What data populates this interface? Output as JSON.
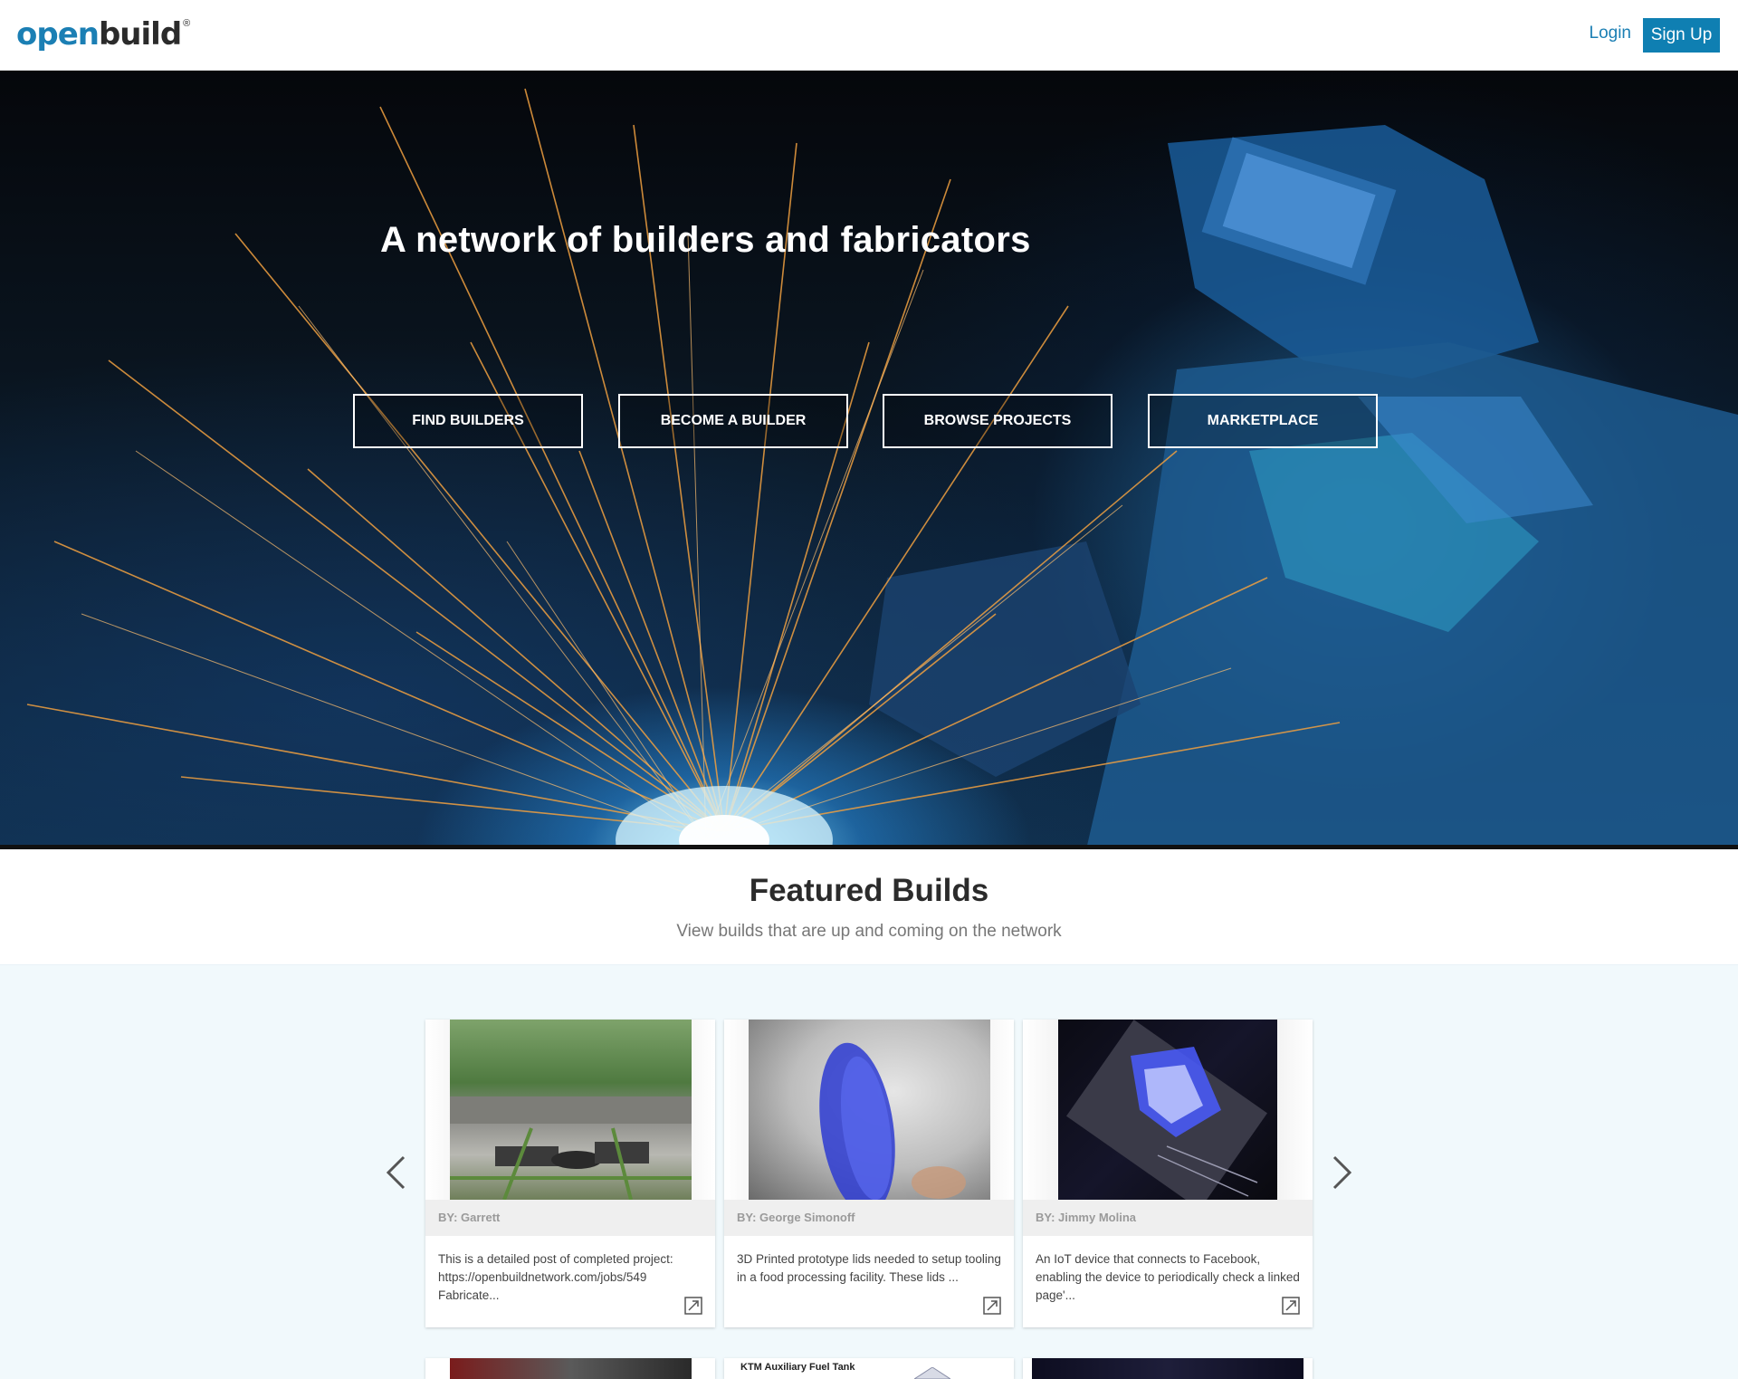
{
  "header": {
    "logo_open": "open",
    "logo_build": "build",
    "logo_reg": "®",
    "login_label": "Login",
    "signup_label": "Sign Up",
    "brand_color": "#1b7fb4"
  },
  "hero": {
    "title": "A network of builders and fabricators",
    "buttons": [
      {
        "label": "FIND BUILDERS"
      },
      {
        "label": "BECOME A BUILDER"
      },
      {
        "label": "BROWSE PROJECTS"
      },
      {
        "label": "MARKETPLACE"
      }
    ]
  },
  "featured": {
    "title": "Featured Builds",
    "subtitle": "View builds that are up and coming on the network",
    "cards": [
      {
        "byline": "BY: Garrett",
        "description": "This is a detailed post of completed project: https://openbuildnetwork.com/jobs/549 Fabricate..."
      },
      {
        "byline": "BY: George Simonoff",
        "description": "3D Printed prototype lids needed to setup tooling in a food processing facility. These lids ..."
      },
      {
        "byline": "BY: Jimmy Molina",
        "description": "An IoT device that connects to Facebook, enabling the device to periodically check a linked page'..."
      }
    ],
    "next_row_visible_text": "KTM Auxiliary Fuel Tank"
  },
  "icons": {
    "prev": "chevron-left-icon",
    "next": "chevron-right-icon",
    "expand": "expand-icon"
  }
}
